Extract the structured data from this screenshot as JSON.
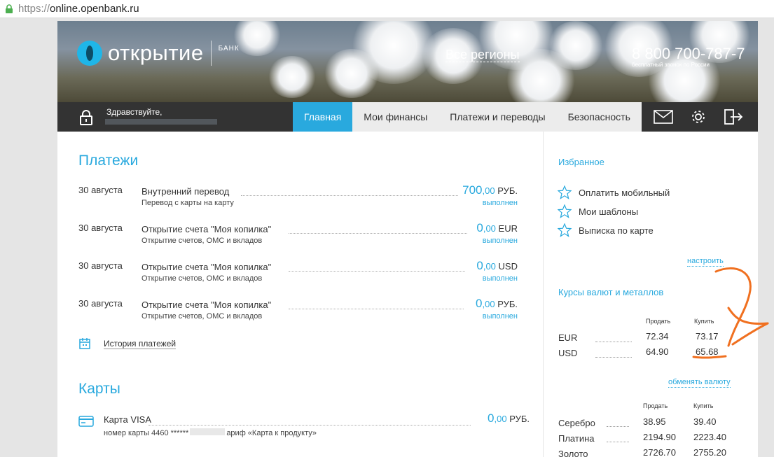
{
  "browser": {
    "url_protocol": "https://",
    "url_host": "online.openbank.ru"
  },
  "header": {
    "logo_text": "ОТКРЫТИЕ",
    "logo_sub": "БАНК",
    "region": "Все регионы",
    "phone": "8 800 700-787-7",
    "phone_note": "бесплатный звонок по России"
  },
  "nav": {
    "greeting": "Здравствуйте,",
    "tabs": [
      "Главная",
      "Мои финансы",
      "Платежи и переводы",
      "Безопасность"
    ],
    "active_tab": "Главная",
    "icons": [
      "mail-icon",
      "settings-gear-icon",
      "logout-icon"
    ]
  },
  "payments": {
    "title": "Платежи",
    "rows": [
      {
        "date": "30 августа",
        "title": "Внутренний перевод",
        "sub": "Перевод с карты на карту",
        "amount_int": "700",
        "amount_dec": ",00",
        "currency": "РУБ.",
        "status": "выполнен"
      },
      {
        "date": "30 августа",
        "title": "Открытие счета \"Моя копилка\"",
        "sub": "Открытие счетов, ОМС и вкладов",
        "amount_int": "0",
        "amount_dec": ",00",
        "currency": "EUR",
        "status": "выполнен"
      },
      {
        "date": "30 августа",
        "title": "Открытие счета \"Моя копилка\"",
        "sub": "Открытие счетов, ОМС и вкладов",
        "amount_int": "0",
        "amount_dec": ",00",
        "currency": "USD",
        "status": "выполнен"
      },
      {
        "date": "30 августа",
        "title": "Открытие счета \"Моя копилка\"",
        "sub": "Открытие счетов, ОМС и вкладов",
        "amount_int": "0",
        "amount_dec": ",00",
        "currency": "РУБ.",
        "status": "выполнен"
      }
    ],
    "history_label": "История платежей"
  },
  "cards": {
    "title": "Карты",
    "card_name": "Карта VISA",
    "card_sub_prefix": "номер карты 4460 ******",
    "card_sub_suffix": "ариф «Карта к продукту»",
    "amount_int": "0",
    "amount_dec": ",00",
    "currency": "РУБ."
  },
  "sidebar": {
    "favorites_title": "Избранное",
    "favorites": [
      "Оплатить мобильный",
      "Мои шаблоны",
      "Выписка по карте"
    ],
    "configure_link": "настроить",
    "rates_title": "Курсы валют и металлов",
    "sell_label": "Продать",
    "buy_label": "Купить",
    "currencies": [
      {
        "name": "EUR",
        "sell": "72.34",
        "buy": "73.17"
      },
      {
        "name": "USD",
        "sell": "64.90",
        "buy": "65.68"
      }
    ],
    "exchange_link": "обменять валюту",
    "metals": [
      {
        "name": "Серебро",
        "sell": "38.95",
        "buy": "39.40"
      },
      {
        "name": "Платина",
        "sell": "2194.90",
        "buy": "2223.40"
      },
      {
        "name": "Золото",
        "sell": "2726.70",
        "buy": "2755.20"
      }
    ]
  },
  "colors": {
    "accent": "#29a9de",
    "nav_bg": "#333333",
    "annotation": "#f07020"
  }
}
